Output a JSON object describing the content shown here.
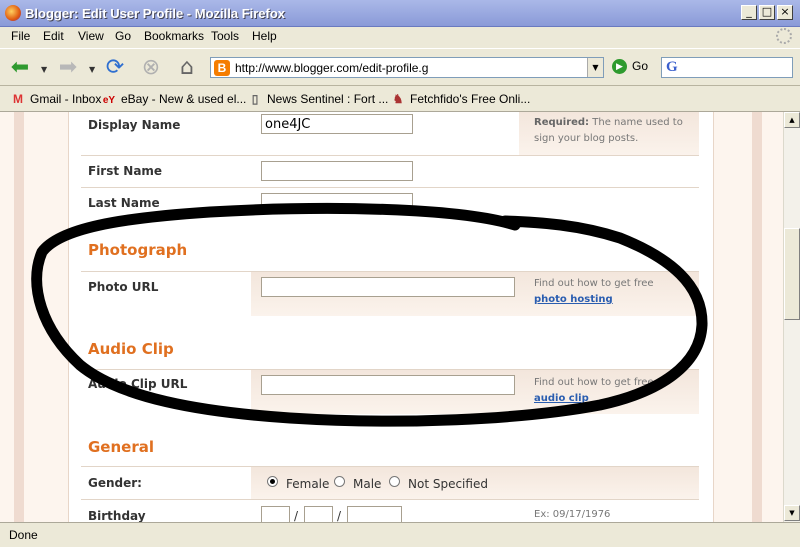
{
  "window": {
    "title": "Blogger: Edit User Profile - Mozilla Firefox"
  },
  "menu": [
    "File",
    "Edit",
    "View",
    "Go",
    "Bookmarks",
    "Tools",
    "Help"
  ],
  "nav": {
    "url": "http://www.blogger.com/edit-profile.g",
    "go_label": "Go"
  },
  "bookmarks": [
    {
      "label": "Gmail - Inbox",
      "icon": "gmail-icon"
    },
    {
      "label": "eBay - New & used el...",
      "icon": "ebay-icon"
    },
    {
      "label": "News Sentinel : Fort ...",
      "icon": "page-icon"
    },
    {
      "label": "Fetchfido's Free Onli...",
      "icon": "dog-icon"
    }
  ],
  "form": {
    "display_name": {
      "label": "Display Name",
      "value": "one4JC"
    },
    "display_name_note": {
      "required": "Required:",
      "text": "The name used to sign your blog posts."
    },
    "first_name": {
      "label": "First Name",
      "value": ""
    },
    "last_name": {
      "label": "Last Name",
      "value": ""
    },
    "photograph": {
      "heading": "Photograph",
      "label": "Photo URL",
      "value": "",
      "note": "Find out how to get free",
      "link": "photo hosting"
    },
    "audio": {
      "heading": "Audio Clip",
      "label": "Audio Clip URL",
      "value": "",
      "note": "Find out how to get free",
      "link": "audio clip"
    },
    "general": {
      "heading": "General",
      "gender_label": "Gender:",
      "gender_options": [
        "Female",
        "Male",
        "Not Specified"
      ],
      "gender_selected": "Female",
      "birthday_label": "Birthday",
      "birthday_sep": "/",
      "birthday_example": "Ex: 09/17/1976"
    }
  },
  "status": {
    "text": "Done"
  },
  "colors": {
    "accent": "#e07020",
    "link": "#2a5db0",
    "annotation": "#000000"
  }
}
